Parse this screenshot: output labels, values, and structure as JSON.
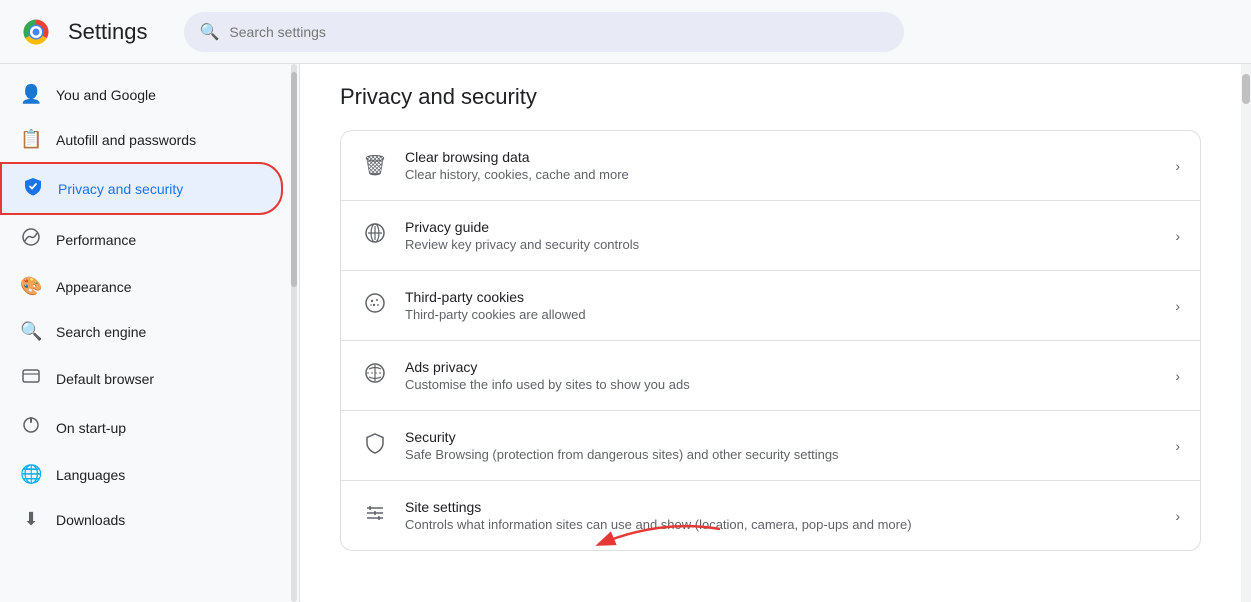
{
  "header": {
    "title": "Settings",
    "search_placeholder": "Search settings"
  },
  "sidebar": {
    "items": [
      {
        "id": "you-google",
        "label": "You and Google",
        "icon": "👤"
      },
      {
        "id": "autofill",
        "label": "Autofill and passwords",
        "icon": "📋"
      },
      {
        "id": "privacy-security",
        "label": "Privacy and security",
        "icon": "shield",
        "active": true
      },
      {
        "id": "performance",
        "label": "Performance",
        "icon": "⚡"
      },
      {
        "id": "appearance",
        "label": "Appearance",
        "icon": "🎨"
      },
      {
        "id": "search-engine",
        "label": "Search engine",
        "icon": "🔍"
      },
      {
        "id": "default-browser",
        "label": "Default browser",
        "icon": "🖥"
      },
      {
        "id": "on-startup",
        "label": "On start-up",
        "icon": "⏻"
      },
      {
        "id": "languages",
        "label": "Languages",
        "icon": "🌐"
      },
      {
        "id": "downloads",
        "label": "Downloads",
        "icon": "⬇"
      }
    ]
  },
  "content": {
    "title": "Privacy and security",
    "rows": [
      {
        "id": "clear-browsing",
        "icon": "🗑",
        "title": "Clear browsing data",
        "desc": "Clear history, cookies, cache and more"
      },
      {
        "id": "privacy-guide",
        "icon": "⊕",
        "title": "Privacy guide",
        "desc": "Review key privacy and security controls"
      },
      {
        "id": "third-party-cookies",
        "icon": "🍪",
        "title": "Third-party cookies",
        "desc": "Third-party cookies are allowed"
      },
      {
        "id": "ads-privacy",
        "icon": "📡",
        "title": "Ads privacy",
        "desc": "Customise the info used by sites to show you ads"
      },
      {
        "id": "security",
        "icon": "🛡",
        "title": "Security",
        "desc": "Safe Browsing (protection from dangerous sites) and other security settings"
      },
      {
        "id": "site-settings",
        "icon": "⚙",
        "title": "Site settings",
        "desc": "Controls what information sites can use and show (location, camera, pop-ups and more)"
      }
    ]
  }
}
